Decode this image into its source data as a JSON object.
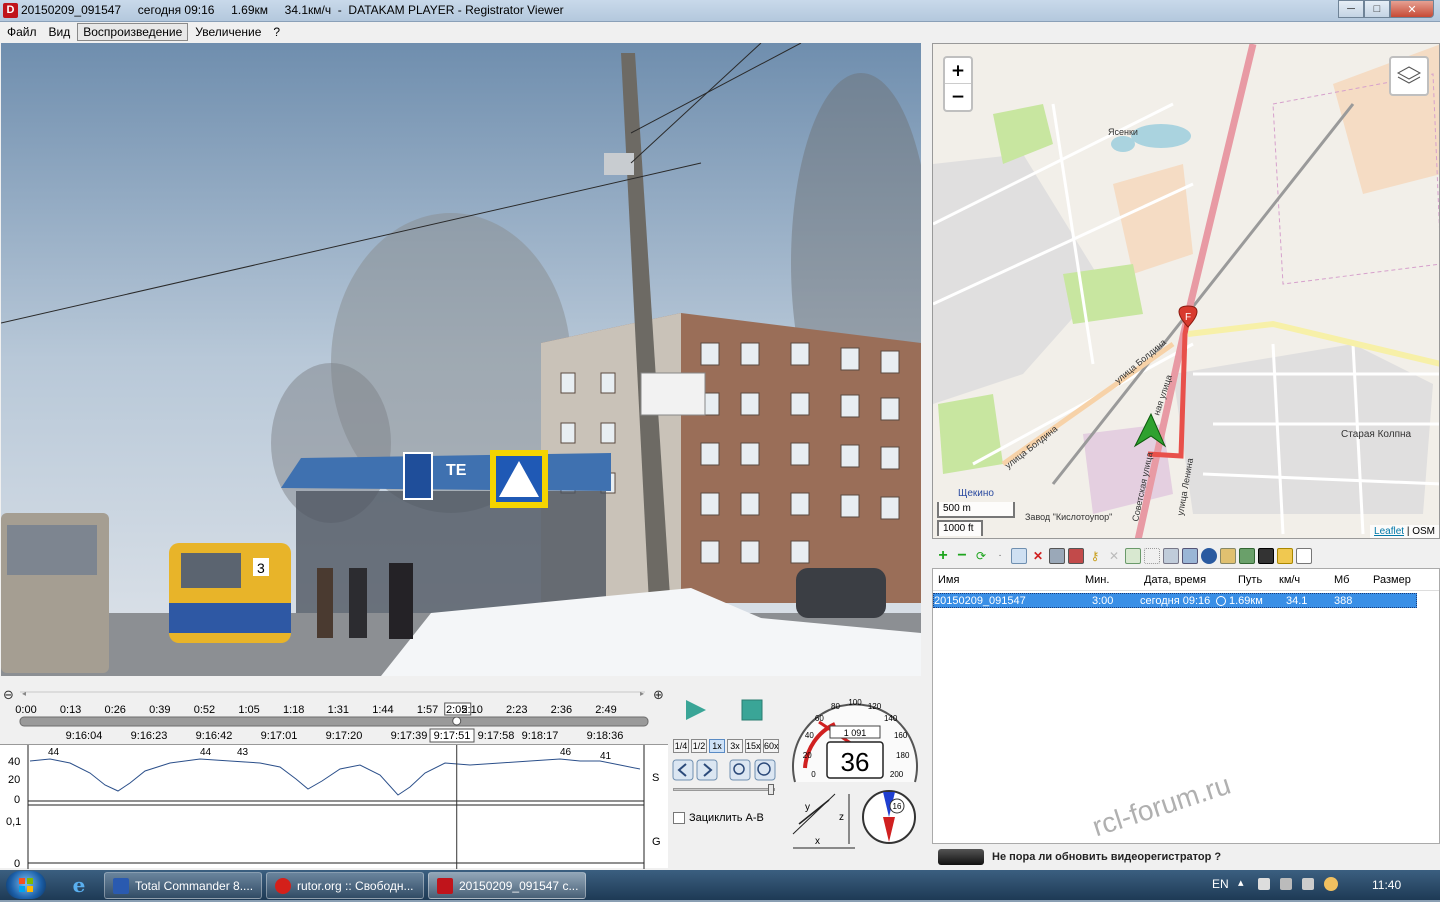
{
  "window": {
    "title": "20150209_091547     сегодня 09:16     1.69км     34.1км/ч  -  DATAKAM PLAYER - Registrator Viewer",
    "icon": "D"
  },
  "menu": [
    "Файл",
    "Вид",
    "Воспроизведение",
    "Увеличение",
    "?"
  ],
  "video": {
    "bus_number": "3",
    "shop_sign": "ТЕ"
  },
  "timeline": {
    "elapsed_ticks": [
      "0:00",
      "0:13",
      "0:26",
      "0:39",
      "0:52",
      "1:05",
      "1:18",
      "1:31",
      "1:44",
      "1:57",
      "2:05",
      "2:10",
      "2:23",
      "2:36",
      "2:49"
    ],
    "clock_ticks": [
      "9:16:04",
      "9:16:23",
      "9:16:42",
      "9:17:01",
      "9:17:20",
      "9:17:39",
      "9:17:51",
      "9:17:58",
      "9:18:17",
      "9:18:36"
    ],
    "current_elapsed": "2:05",
    "current_clock": "9:17:51",
    "zoom_out_icon": "⊖",
    "zoom_in_icon": "⊕",
    "position_fraction": 0.6957
  },
  "graph": {
    "speed_axis": [
      "40",
      "20",
      "0"
    ],
    "g_axis": [
      "0,1",
      "0"
    ],
    "speed_label": "S",
    "g_label": "G",
    "speed_annotations": [
      "44",
      "44",
      "43",
      "46",
      "41"
    ]
  },
  "controls": {
    "speeds": [
      "1/4",
      "1/2",
      "1x",
      "3x",
      "15x",
      "60x"
    ],
    "selected_speed": "1x",
    "loop_label": "Зациклить A-B"
  },
  "gauge": {
    "speed": "36",
    "odometer": "1 091",
    "scale": [
      "0",
      "20",
      "40",
      "60",
      "80",
      "100",
      "120",
      "140",
      "160",
      "180",
      "200"
    ],
    "compass_heading": "16",
    "accel_labels": [
      "y",
      "x",
      "z"
    ]
  },
  "map": {
    "zoom_in": "+",
    "zoom_out": "−",
    "places": [
      "Ясенки",
      "Старая Колпна",
      "Щекино",
      "Завод \"Кислотоупор\""
    ],
    "streets": [
      "улица Болдина",
      "улица Болдина",
      "Советская улица",
      "улица Ленина",
      "ная улица"
    ],
    "scale_metric": "500 m",
    "scale_imperial": "1000 ft",
    "attribution_link": "Leaflet",
    "attribution_text": " | OSM",
    "finish_marker": "F",
    "colors": {
      "route": "#e8504a",
      "water": "#aad3df",
      "green": "#c8e6a0",
      "land": "#f2efe9"
    }
  },
  "file_list": {
    "columns": [
      "Имя",
      "Мин.",
      "Дата, время",
      "Путь",
      "км/ч",
      "Мб",
      "Размер"
    ],
    "rows": [
      {
        "name": "20150209_091547",
        "minutes": "3:00",
        "datetime": "сегодня 09:16",
        "path": "1.69км",
        "speed": "34.1",
        "mb": "388"
      }
    ]
  },
  "banner": {
    "text": "Не пора ли обновить видеорегистратор ?"
  },
  "watermark": "rcl-forum.ru",
  "taskbar": {
    "tasks": [
      "Total Commander 8....",
      "rutor.org :: Свободн...",
      "20150209_091547     с..."
    ],
    "language": "EN",
    "clock": "11:40"
  }
}
